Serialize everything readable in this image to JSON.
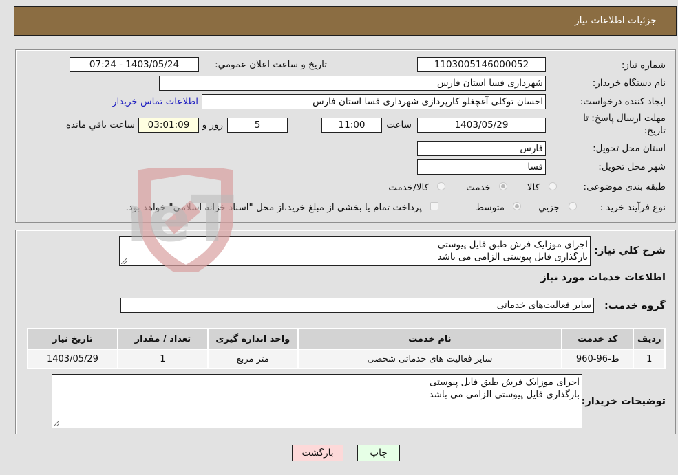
{
  "header": {
    "title": "جزئیات اطلاعات نیاز"
  },
  "form": {
    "need_number": {
      "label": "شماره نیاز:",
      "value": "1103005146000052"
    },
    "announce_datetime": {
      "label": "تاريخ و ساعت اعلان عمومي:",
      "value": "1403/05/24 - 07:24"
    },
    "buyer_org": {
      "label": "نام دستگاه خريدار:",
      "value": "شهرداری فسا استان فارس"
    },
    "requester": {
      "label": "ايجاد کننده درخواست:",
      "value": "احسان توکلی آغچغلو کارپردازی شهرداری فسا استان فارس"
    },
    "contact_link": "اطلاعات تماس خریدار",
    "deadline": {
      "label_line1": "مهلت ارسال پاسخ: تا",
      "label_line2": "تاريخ:",
      "date": "1403/05/29",
      "time_label": "ساعت",
      "time": "11:00",
      "days": "5",
      "days_label": "روز و",
      "remaining": "03:01:09",
      "remaining_label": "ساعت باقي مانده"
    },
    "delivery_province": {
      "label": "استان محل تحويل:",
      "value": "فارس"
    },
    "delivery_city": {
      "label": "شهر محل تحويل:",
      "value": "فسا"
    },
    "category": {
      "label": "طبقه بندی موضوعی:",
      "options": [
        {
          "label": "کالا",
          "checked": false
        },
        {
          "label": "خدمت",
          "checked": true
        },
        {
          "label": "کالا/خدمت",
          "checked": false
        }
      ]
    },
    "purchase_process": {
      "label": "نوع فرآيند خريد :",
      "options": [
        {
          "label": "جزيي",
          "checked": false
        },
        {
          "label": "متوسط",
          "checked": true
        }
      ],
      "treasury_note": "پرداخت تمام یا بخشی از مبلغ خرید،از محل \"اسناد خزانه اسلامی\" خواهد بود.",
      "treasury_checked": false
    }
  },
  "details": {
    "general_desc_label": "شرح کلي نياز:",
    "general_desc_lines": [
      "اجرای موزایک فرش طبق فایل پیوستی",
      "بارگذاری فایل پیوستی الزامی می باشد"
    ],
    "services_heading": "اطلاعات خدمات مورد نياز",
    "service_group_label": "گروه خدمت:",
    "service_group_value": "سایر فعالیت‌های خدماتی",
    "table": {
      "headers": [
        "رديف",
        "کد خدمت",
        "نام خدمت",
        "واحد اندازه گيری",
        "تعداد / مقدار",
        "تاريخ نياز"
      ],
      "rows": [
        [
          "1",
          "ط-96-960",
          "سایر فعالیت های خدماتی شخصی",
          "متر مربع",
          "1",
          "1403/05/29"
        ]
      ]
    },
    "buyer_notes_label": "توضيحات خريدار:",
    "buyer_notes_lines": [
      "اجرای موزایک فرش طبق فایل پیوستی",
      "بارگذاری فایل پیوستی الزامی می باشد"
    ]
  },
  "buttons": {
    "print": "چاپ",
    "back": "بازگشت"
  },
  "watermark": {
    "text": "AriaTender.neT"
  },
  "colors": {
    "header_bg": "#8b6d42",
    "back_btn": "#fdd9d9",
    "print_btn": "#e6ffe6",
    "link": "#2020c0",
    "remaining_bg": "#ffffe1"
  }
}
